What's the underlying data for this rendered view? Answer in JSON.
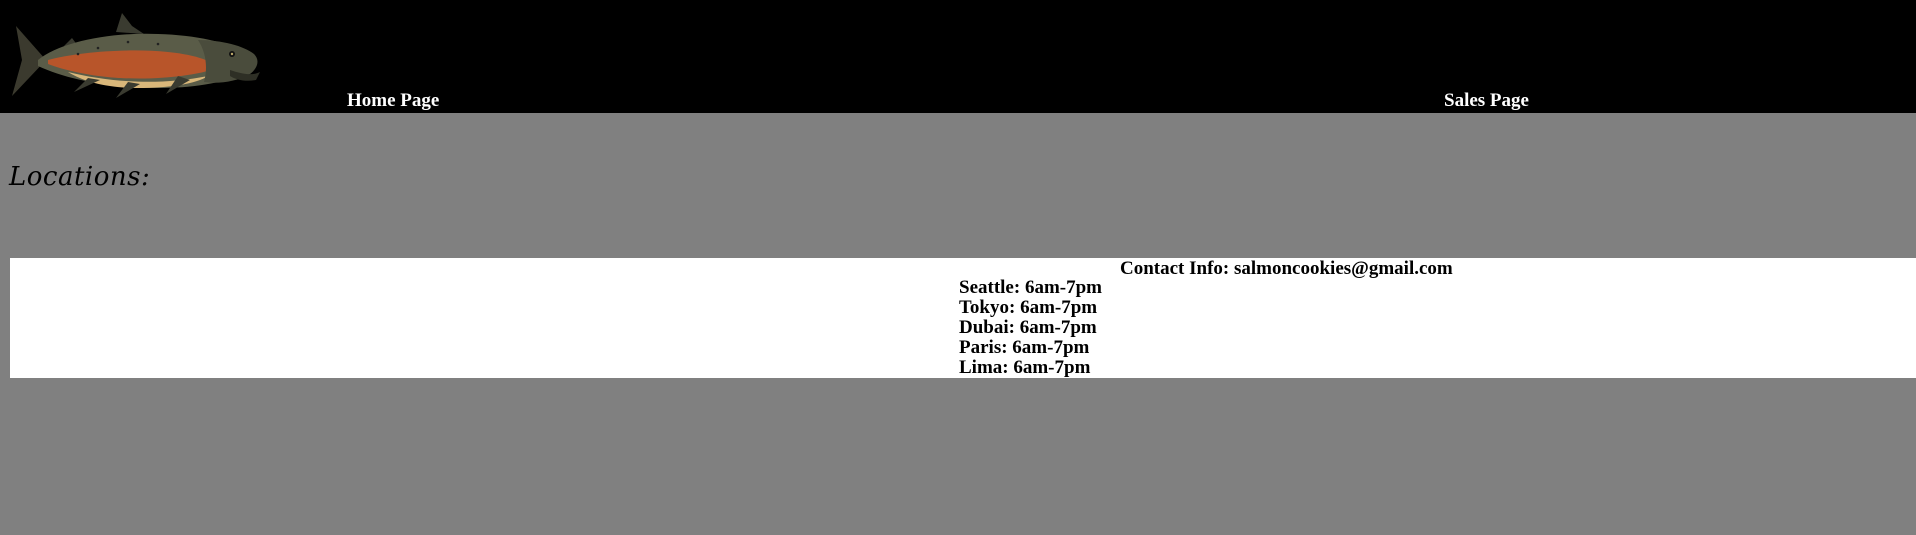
{
  "colors": {
    "header_bg": "#000000",
    "page_bg": "#808080",
    "panel_bg": "#ffffff",
    "nav_text": "#ffffff",
    "body_text": "#000000"
  },
  "header": {
    "logo_icon": "salmon-fish-icon",
    "nav": {
      "home_label": "Home Page",
      "sales_label": "Sales Page"
    }
  },
  "main": {
    "heading": "Locations:",
    "contact": "Contact Info: salmoncookies@gmail.com",
    "locations": [
      {
        "text": "Seattle: 6am-7pm"
      },
      {
        "text": "Tokyo: 6am-7pm"
      },
      {
        "text": "Dubai: 6am-7pm"
      },
      {
        "text": "Paris: 6am-7pm"
      },
      {
        "text": "Lima: 6am-7pm"
      }
    ]
  }
}
